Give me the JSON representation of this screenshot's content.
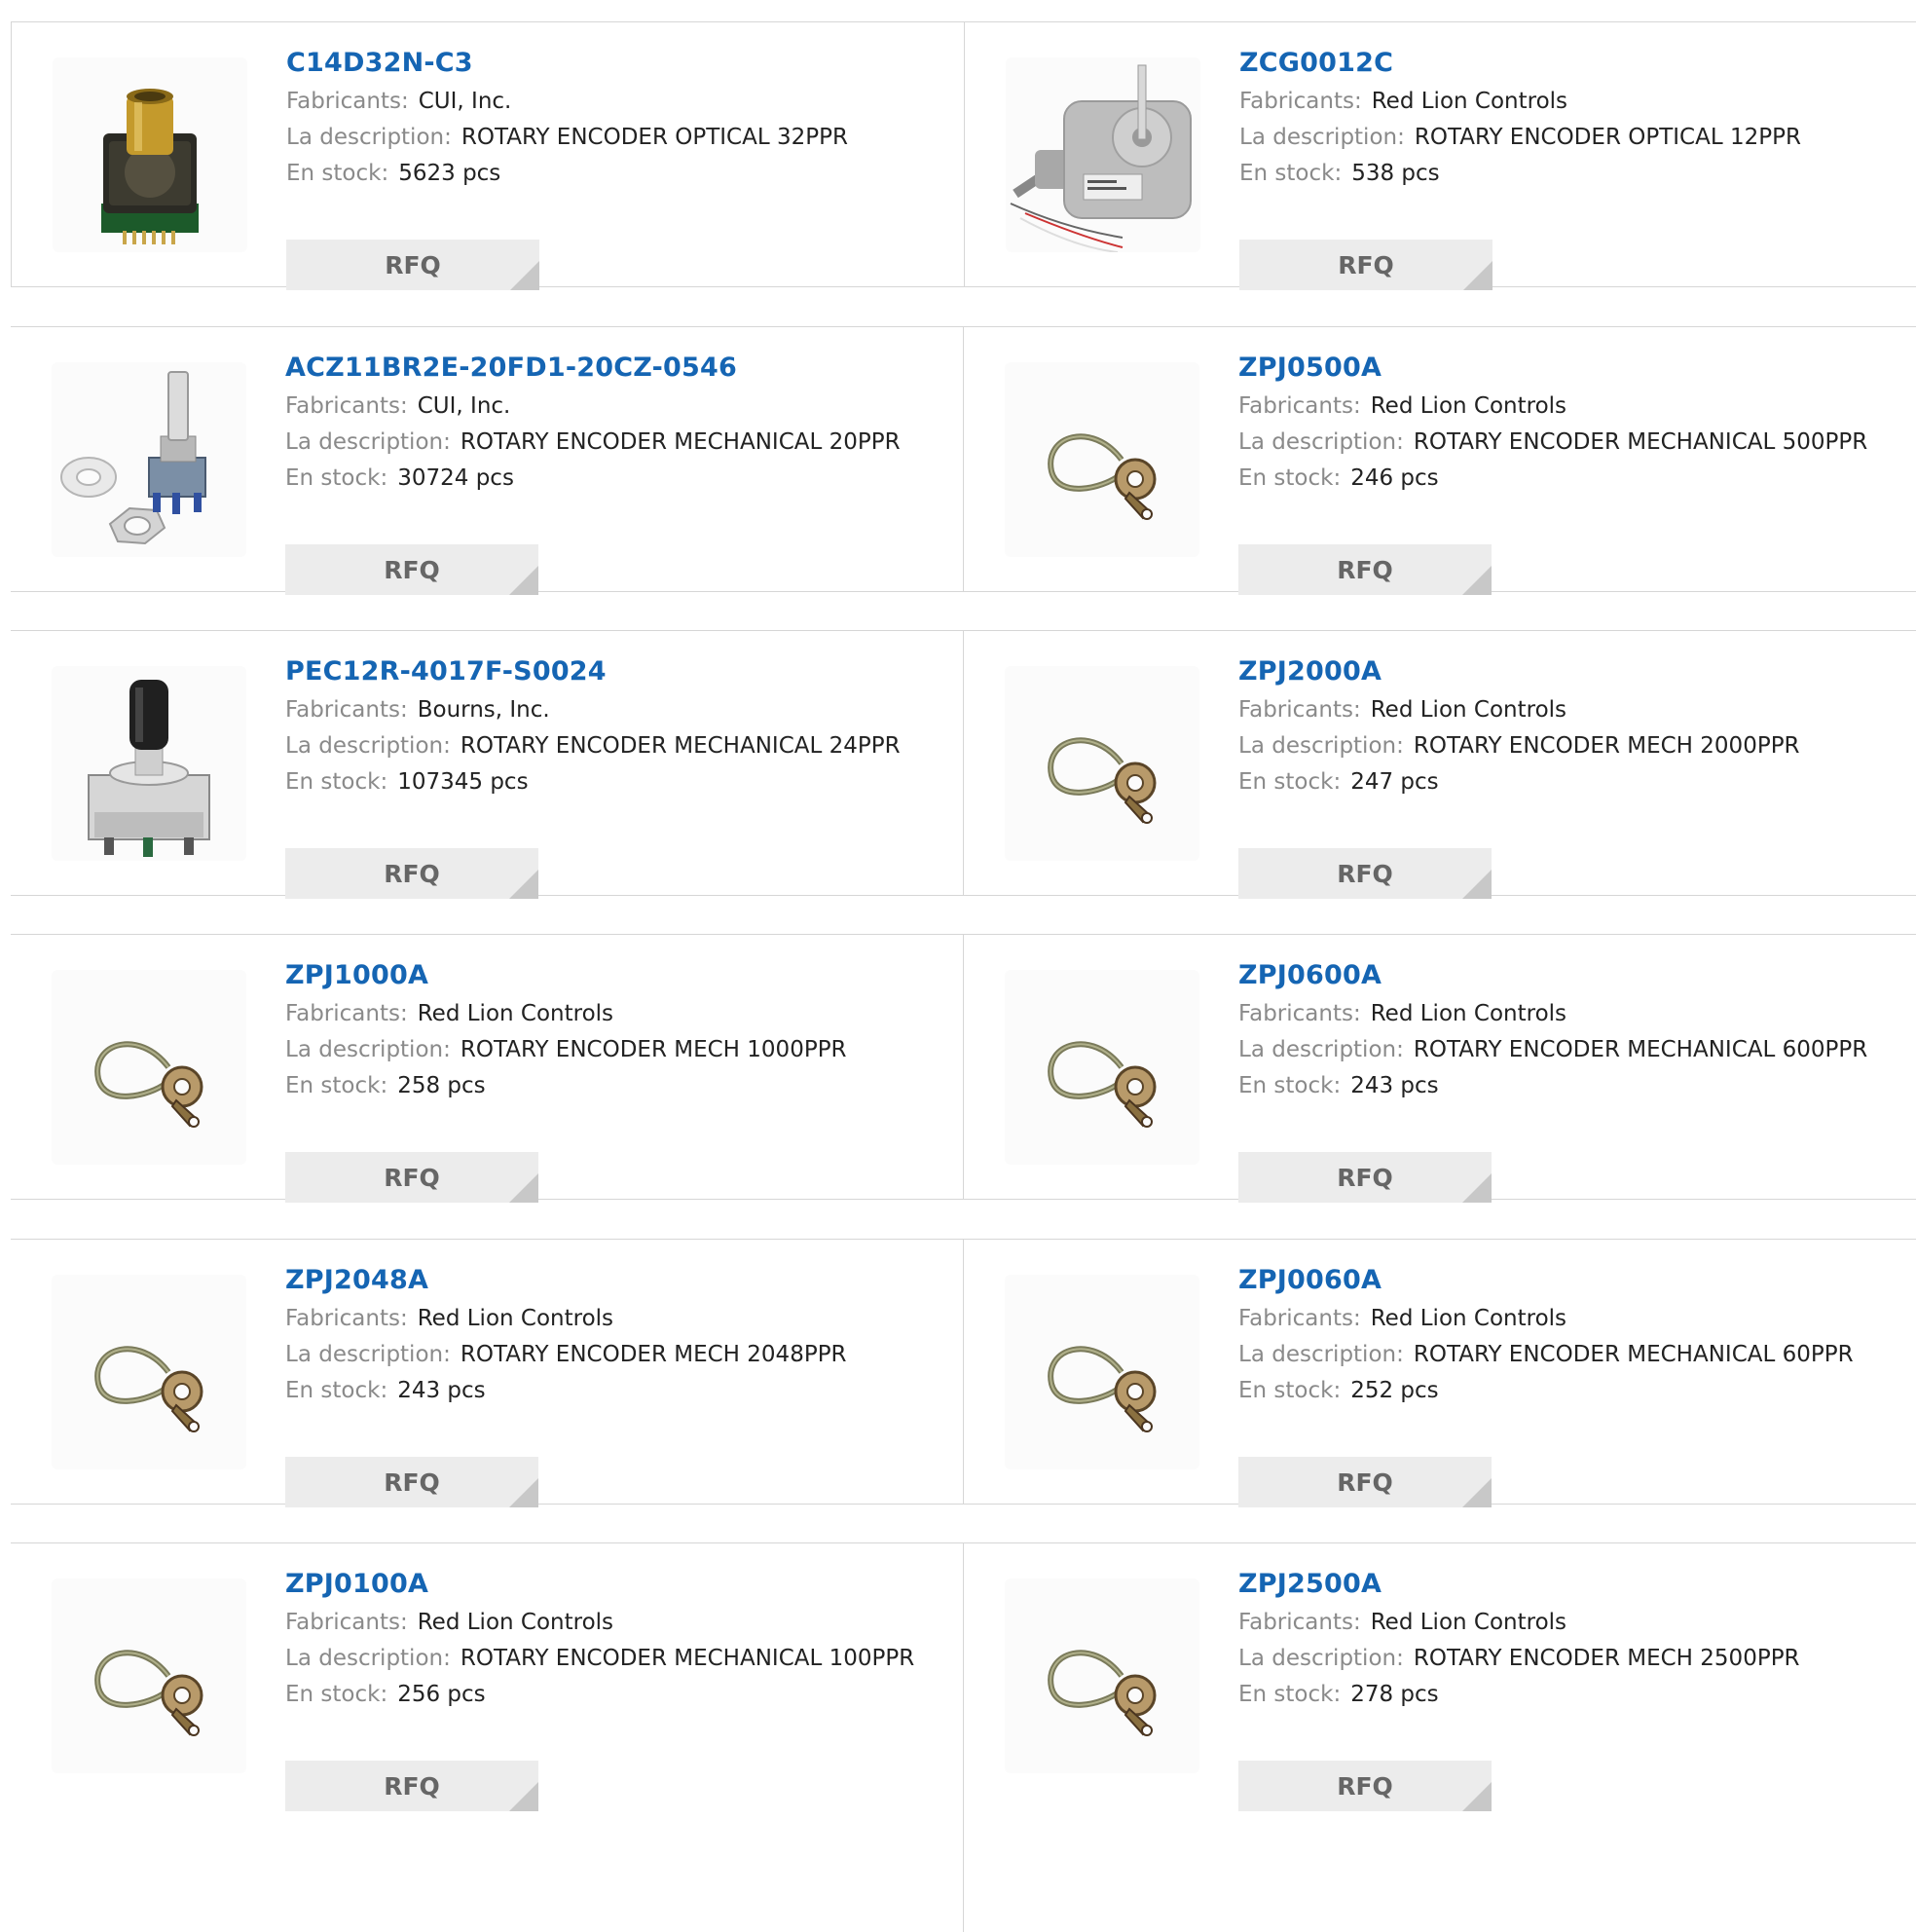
{
  "labels": {
    "manufacturer": "Fabricants:",
    "description": "La description:",
    "stock": "En stock:",
    "rfq": "RFQ"
  },
  "products": [
    {
      "part_number": "C14D32N-C3",
      "manufacturer": "CUI, Inc.",
      "description": "ROTARY ENCODER OPTICAL 32PPR",
      "stock": "5623 pcs",
      "image": "panel-encoder-brass-icon"
    },
    {
      "part_number": "ZCG0012C",
      "manufacturer": "Red Lion Controls",
      "description": "ROTARY ENCODER OPTICAL 12PPR",
      "stock": "538 pcs",
      "image": "housing-encoder-cable-icon"
    },
    {
      "part_number": "ACZ11BR2E-20FD1-20CZ-0546",
      "manufacturer": "CUI, Inc.",
      "description": "ROTARY ENCODER MECHANICAL 20PPR",
      "stock": "30724 pcs",
      "image": "shaft-encoder-washer-nut-icon"
    },
    {
      "part_number": "ZPJ0500A",
      "manufacturer": "Red Lion Controls",
      "description": "ROTARY ENCODER MECHANICAL 500PPR",
      "stock": "246 pcs",
      "image": "cable-loop-encoder-icon"
    },
    {
      "part_number": "PEC12R-4017F-S0024",
      "manufacturer": "Bourns, Inc.",
      "description": "ROTARY ENCODER MECHANICAL 24PPR",
      "stock": "107345 pcs",
      "image": "knob-encoder-icon"
    },
    {
      "part_number": "ZPJ2000A",
      "manufacturer": "Red Lion Controls",
      "description": "ROTARY ENCODER MECH 2000PPR",
      "stock": "247 pcs",
      "image": "cable-loop-encoder-icon"
    },
    {
      "part_number": "ZPJ1000A",
      "manufacturer": "Red Lion Controls",
      "description": "ROTARY ENCODER MECH 1000PPR",
      "stock": "258 pcs",
      "image": "cable-loop-encoder-icon"
    },
    {
      "part_number": "ZPJ0600A",
      "manufacturer": "Red Lion Controls",
      "description": "ROTARY ENCODER MECHANICAL 600PPR",
      "stock": "243 pcs",
      "image": "cable-loop-encoder-icon"
    },
    {
      "part_number": "ZPJ2048A",
      "manufacturer": "Red Lion Controls",
      "description": "ROTARY ENCODER MECH 2048PPR",
      "stock": "243 pcs",
      "image": "cable-loop-encoder-icon"
    },
    {
      "part_number": "ZPJ0060A",
      "manufacturer": "Red Lion Controls",
      "description": "ROTARY ENCODER MECHANICAL 60PPR",
      "stock": "252 pcs",
      "image": "cable-loop-encoder-icon"
    },
    {
      "part_number": "ZPJ0100A",
      "manufacturer": "Red Lion Controls",
      "description": "ROTARY ENCODER MECHANICAL 100PPR",
      "stock": "256 pcs",
      "image": "cable-loop-encoder-icon"
    },
    {
      "part_number": "ZPJ2500A",
      "manufacturer": "Red Lion Controls",
      "description": "ROTARY ENCODER MECH 2500PPR",
      "stock": "278 pcs",
      "image": "cable-loop-encoder-icon"
    }
  ],
  "colors": {
    "part_link": "#1565b3",
    "label": "#8a8a8a",
    "value": "#222222",
    "rfq_bg": "#ececec",
    "border": "#d6d6d6"
  }
}
